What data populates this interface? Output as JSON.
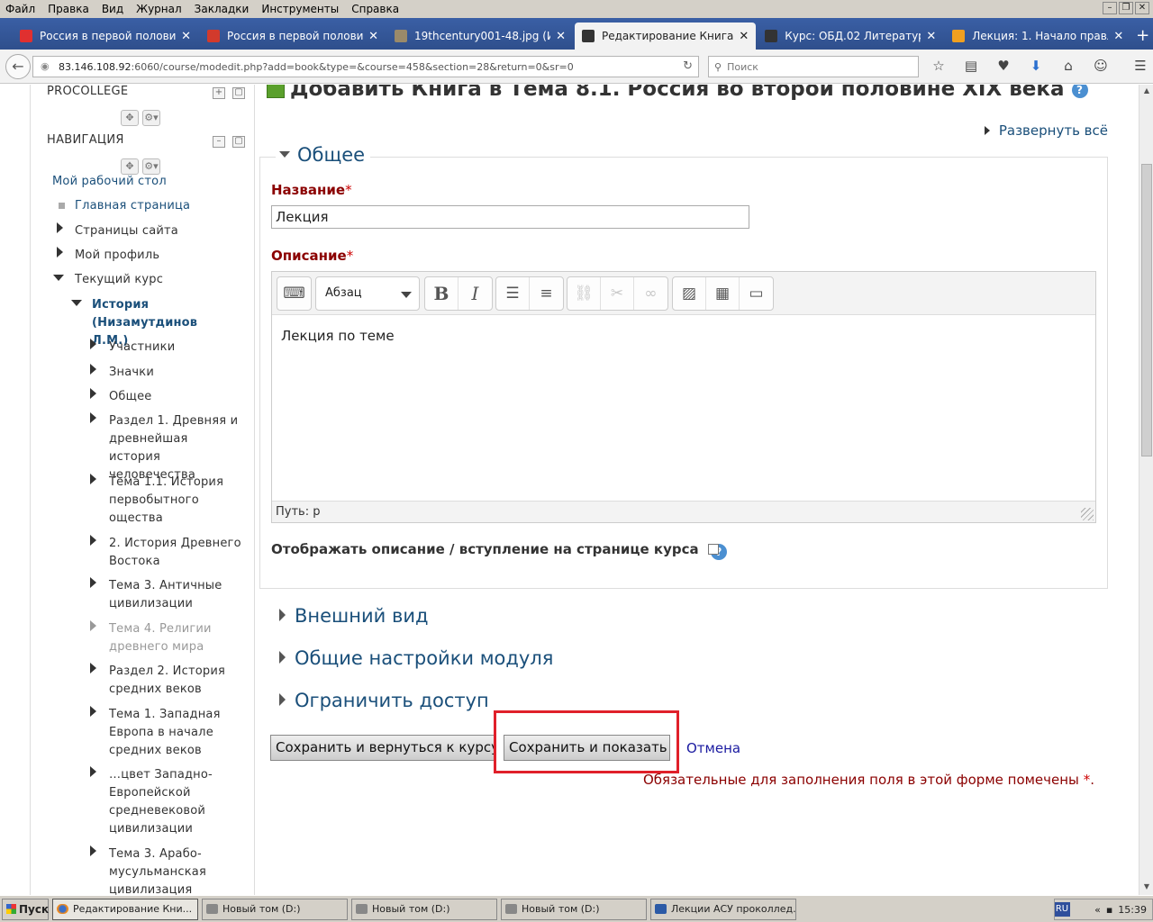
{
  "menubar": {
    "items": [
      "Файл",
      "Правка",
      "Вид",
      "Журнал",
      "Закладки",
      "Инструменты",
      "Справка"
    ]
  },
  "tabs": [
    {
      "title": "Россия в первой половине...",
      "icon_color": "#e03030",
      "active": false
    },
    {
      "title": "Россия в первой половине...",
      "icon_color": "#d23a2c",
      "active": false
    },
    {
      "title": "19thcentury001-48.jpg (Из...",
      "icon_color": "#9a8a6a",
      "active": false
    },
    {
      "title": "Редактирование Книга",
      "icon_color": "#333333",
      "active": true
    },
    {
      "title": "Курс: ОБД.02 Литература",
      "icon_color": "#333333",
      "active": false
    },
    {
      "title": "Лекция: 1. Начало правле...",
      "icon_color": "#f0a020",
      "active": false
    }
  ],
  "navbar": {
    "url_host": "83.146.108.92",
    "url_rest": ":6060/course/modedit.php?add=book&type=&course=458&section=28&return=0&sr=0",
    "search_placeholder": "Поиск"
  },
  "sidebar": {
    "block1_title": "PROCOLLEGE",
    "block2_title": "НАВИГАЦИЯ",
    "items": [
      "Мой рабочий стол",
      "Главная страница",
      "Страницы сайта",
      "Мой профиль",
      "Текущий курс",
      "История (Низамутдинов Л.М.)",
      "Участники",
      "Значки",
      "Общее",
      "Раздел 1. Древняя и древнейшая история человечества",
      "Тема 1.1. История первобытного ощества",
      "2. История Древнего Востока",
      "Тема 3. Античные цивилизации",
      "Тема 4. Религии древнего мира",
      "Раздел 2. История средних веков",
      "Тема 1. Западная Европа в начале средних веков",
      "…цвет Западно-Европейской средневековой цивилизации",
      "Тема 3. Арабо-мусульманская цивилизация"
    ]
  },
  "main": {
    "page_title": "Добавить Книга в Тема 8.1. Россия во второй половине XIX века",
    "expand_all": "Развернуть всё",
    "general_legend": "Общее",
    "name_label": "Название",
    "name_value": "Лекция",
    "desc_label": "Описание",
    "format_select": "Абзац",
    "editor_text": "Лекция по теме",
    "path_label": "Путь: p",
    "show_desc_label": "Отображать описание / вступление на странице курса",
    "sections": [
      "Внешний вид",
      "Общие настройки модуля",
      "Ограничить доступ"
    ],
    "save_return_label": "Сохранить и вернуться к курсу",
    "save_display_label": "Сохранить и показать",
    "cancel_label": "Отмена",
    "required_note": "Обязательные для заполнения поля в этой форме помечены",
    "required_star": "*"
  },
  "taskbar": {
    "start": "Пуск",
    "tasks": [
      "Редактирование Кни...",
      "Новый том (D:)",
      "Новый том (D:)",
      "Новый том (D:)",
      "Лекции АСУ проколлед..."
    ],
    "lang": "RU",
    "clock": "15:39"
  },
  "colors": {
    "highlight": "#e0202a",
    "link": "#1a4f7a",
    "required": "#8b0000"
  }
}
